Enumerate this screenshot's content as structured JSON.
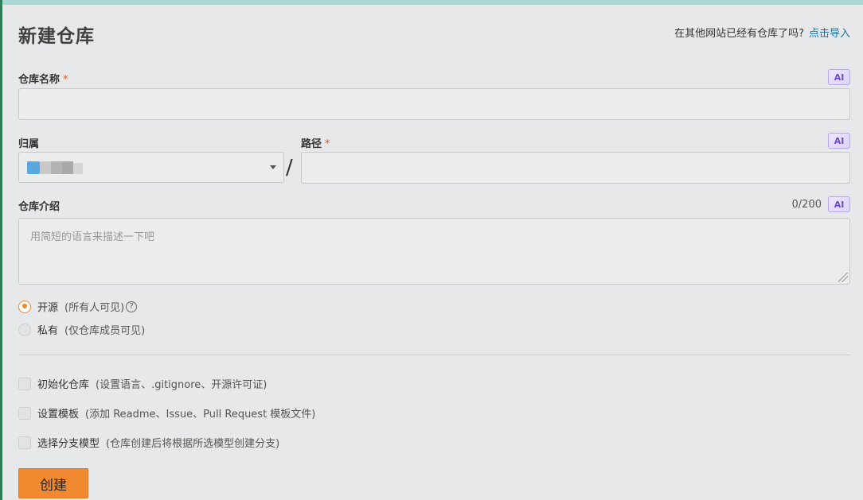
{
  "header": {
    "title": "新建仓库",
    "import_prompt": "在其他网站已经有仓库了吗?",
    "import_link": "点击导入"
  },
  "form": {
    "repo_name": {
      "label": "仓库名称",
      "required_mark": "*",
      "value": ""
    },
    "owner": {
      "label": "归属"
    },
    "separator": "/",
    "path": {
      "label": "路径",
      "required_mark": "*",
      "value": ""
    },
    "description": {
      "label": "仓库介绍",
      "counter": "0/200",
      "placeholder": "用简短的语言来描述一下吧"
    },
    "ai_badge": "AI",
    "visibility": [
      {
        "label": "开源",
        "hint": "(所有人可见)",
        "selected": true,
        "help_icon": "?"
      },
      {
        "label": "私有",
        "hint": "(仅仓库成员可见)",
        "selected": false
      }
    ],
    "options": [
      {
        "label": "初始化仓库",
        "hint": "(设置语言、.gitignore、开源许可证)",
        "checked": false
      },
      {
        "label": "设置模板",
        "hint": "(添加 Readme、Issue、Pull Request 模板文件)",
        "checked": false
      },
      {
        "label": "选择分支模型",
        "hint": "(仓库创建后将根据所选模型创建分支)",
        "checked": false
      }
    ],
    "submit_label": "创建"
  },
  "colors": {
    "accent": "#f0892f",
    "link": "#1d6fa5",
    "ai_badge": "#6a4cc7",
    "required": "#e05a2b"
  },
  "icons": {
    "dropdown": "chevron-down-icon",
    "help": "help-circle-icon",
    "resize": "resize-handle-icon"
  }
}
